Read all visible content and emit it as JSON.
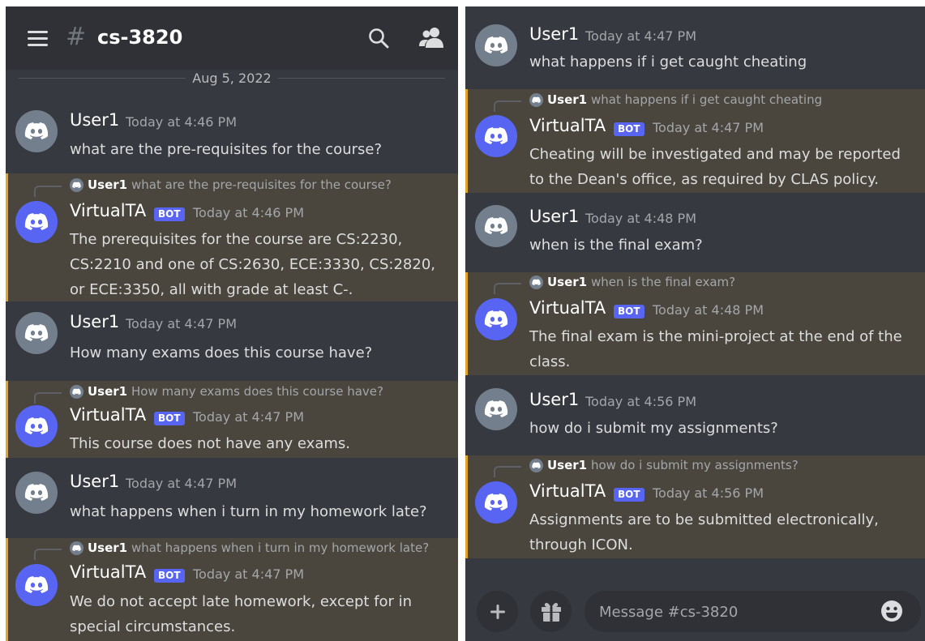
{
  "header": {
    "channel_hash": "#",
    "channel_name": "cs-3820",
    "date_separator": "Aug 5, 2022"
  },
  "left_messages": [
    {
      "type": "user",
      "author": "User1",
      "timestamp": "Today at 4:46 PM",
      "text": "what are the pre-requisites for the course?"
    },
    {
      "type": "bot",
      "reply_author": "User1",
      "reply_text": "what are the pre-requisites for the course?",
      "author": "VirtualTA",
      "badge": "BOT",
      "timestamp": "Today at 4:46 PM",
      "text": "The prerequisites for the course are CS:2230, CS:2210 and one of CS:2630, ECE:3330, CS:2820, or ECE:3350, all with grade at least C-."
    },
    {
      "type": "user",
      "author": "User1",
      "timestamp": "Today at 4:47 PM",
      "text": "How many exams does this course have?"
    },
    {
      "type": "bot",
      "reply_author": "User1",
      "reply_text": "How many exams does this course have?",
      "author": "VirtualTA",
      "badge": "BOT",
      "timestamp": "Today at 4:47 PM",
      "text": "This course does not have any exams."
    },
    {
      "type": "user",
      "author": "User1",
      "timestamp": "Today at 4:47 PM",
      "text": "what happens when i turn in my homework late?"
    },
    {
      "type": "bot",
      "reply_author": "User1",
      "reply_text": "what happens when i turn in my homework late?",
      "author": "VirtualTA",
      "badge": "BOT",
      "timestamp": "Today at 4:47 PM",
      "text": "We do not accept late homework, except for in special circumstances."
    }
  ],
  "right_messages": [
    {
      "type": "user",
      "author": "User1",
      "timestamp": "Today at 4:47 PM",
      "text": "what happens if i get caught cheating"
    },
    {
      "type": "bot",
      "reply_author": "User1",
      "reply_text": "what happens if i get caught cheating",
      "author": "VirtualTA",
      "badge": "BOT",
      "timestamp": "Today at 4:47 PM",
      "text": "Cheating will be investigated and may be reported to the Dean's office, as required by CLAS policy."
    },
    {
      "type": "user",
      "author": "User1",
      "timestamp": "Today at 4:48 PM",
      "text": "when is the final exam?"
    },
    {
      "type": "bot",
      "reply_author": "User1",
      "reply_text": "when is the final exam?",
      "author": "VirtualTA",
      "badge": "BOT",
      "timestamp": "Today at 4:48 PM",
      "text": "The final exam is the mini-project at the end of the class."
    },
    {
      "type": "user",
      "author": "User1",
      "timestamp": "Today at 4:56 PM",
      "text": "how do i submit my assignments?"
    },
    {
      "type": "bot",
      "reply_author": "User1",
      "reply_text": "how do i submit my assignments?",
      "author": "VirtualTA",
      "badge": "BOT",
      "timestamp": "Today at 4:56 PM",
      "text": "Assignments are to be submitted electronically, through ICON."
    }
  ],
  "composer": {
    "placeholder": "Message #cs-3820"
  },
  "colors": {
    "background": "#36393f",
    "header": "#2f3136",
    "bot_highlight": "#4b463d",
    "mention_bar": "#e2a527",
    "blurple": "#5865f2",
    "user_avatar": "#747f8d"
  },
  "icons": [
    "hamburger-icon",
    "search-icon",
    "members-icon",
    "discord-icon",
    "plus-icon",
    "gift-icon",
    "emoji-icon"
  ]
}
